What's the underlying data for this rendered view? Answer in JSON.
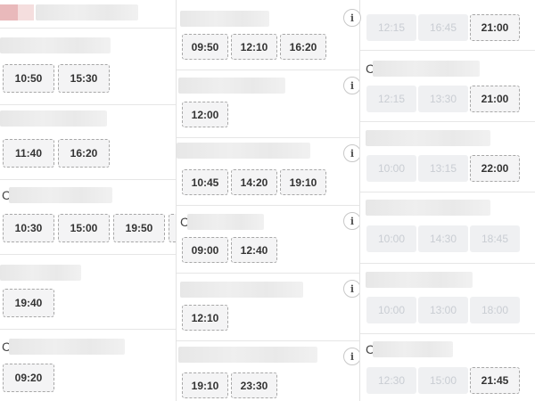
{
  "columns": [
    {
      "name": "left",
      "groups": [
        {
          "title_fragment": "",
          "times": [
            {
              "time": "10:50",
              "available": true
            },
            {
              "time": "15:30",
              "available": true
            }
          ]
        },
        {
          "title_fragment": "",
          "times": [
            {
              "time": "11:40",
              "available": true
            },
            {
              "time": "16:20",
              "available": true
            }
          ]
        },
        {
          "title_fragment": "C",
          "times": [
            {
              "time": "10:30",
              "available": true
            },
            {
              "time": "15:00",
              "available": true
            },
            {
              "time": "19:50",
              "available": true
            },
            {
              "time": "",
              "available": true
            }
          ]
        },
        {
          "title_fragment": "",
          "times": [
            {
              "time": "19:40",
              "available": true
            }
          ]
        },
        {
          "title_fragment": "C",
          "times": [
            {
              "time": "09:20",
              "available": true
            }
          ]
        }
      ]
    },
    {
      "name": "middle",
      "groups": [
        {
          "title_fragment": "",
          "times": [
            {
              "time": "09:50",
              "available": true
            },
            {
              "time": "12:10",
              "available": true
            },
            {
              "time": "16:20",
              "available": true
            }
          ]
        },
        {
          "title_fragment": "",
          "times": [
            {
              "time": "12:00",
              "available": true
            }
          ]
        },
        {
          "title_fragment": "",
          "times": [
            {
              "time": "10:45",
              "available": true
            },
            {
              "time": "14:20",
              "available": true
            },
            {
              "time": "19:10",
              "available": true
            }
          ]
        },
        {
          "title_fragment": "C",
          "times": [
            {
              "time": "09:00",
              "available": true
            },
            {
              "time": "12:40",
              "available": true
            }
          ]
        },
        {
          "title_fragment": "",
          "times": [
            {
              "time": "12:10",
              "available": true
            }
          ]
        },
        {
          "title_fragment": "",
          "times": [
            {
              "time": "19:10",
              "available": true
            },
            {
              "time": "23:30",
              "available": true
            }
          ]
        }
      ]
    },
    {
      "name": "right",
      "groups": [
        {
          "title_fragment": "",
          "times": [
            {
              "time": "12:15",
              "available": false
            },
            {
              "time": "16:45",
              "available": false
            },
            {
              "time": "21:00",
              "available": true
            }
          ]
        },
        {
          "title_fragment": "C",
          "times": [
            {
              "time": "12:15",
              "available": false
            },
            {
              "time": "13:30",
              "available": false
            },
            {
              "time": "21:00",
              "available": true
            }
          ]
        },
        {
          "title_fragment": "",
          "times": [
            {
              "time": "10:00",
              "available": false
            },
            {
              "time": "13:15",
              "available": false
            },
            {
              "time": "22:00",
              "available": true
            }
          ]
        },
        {
          "title_fragment": "",
          "times": [
            {
              "time": "10:00",
              "available": false
            },
            {
              "time": "14:30",
              "available": false
            },
            {
              "time": "18:45",
              "available": false
            }
          ]
        },
        {
          "title_fragment": "",
          "times": [
            {
              "time": "10:00",
              "available": false
            },
            {
              "time": "13:00",
              "available": false
            },
            {
              "time": "18:00",
              "available": false
            }
          ]
        },
        {
          "title_fragment": "C",
          "times": [
            {
              "time": "12:30",
              "available": false
            },
            {
              "time": "15:00",
              "available": false
            },
            {
              "time": "21:45",
              "available": true
            }
          ]
        }
      ]
    }
  ],
  "info_icon_glyph": "i",
  "colors": {
    "chip_bg": "#f4f4f5",
    "chip_border": "#a8a8a8",
    "disabled_bg": "#eff0f2",
    "disabled_text": "#c9cdd3",
    "accent_pink": "#e9b9bb"
  }
}
